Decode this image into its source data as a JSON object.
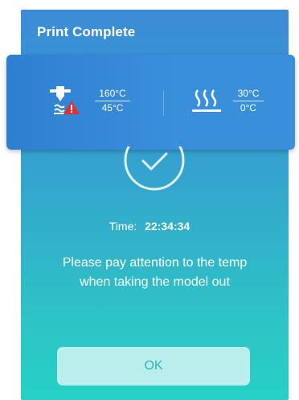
{
  "dialog": {
    "title": "Print Complete"
  },
  "temperatures": {
    "nozzle": {
      "icon": "nozzle-warning-icon",
      "target": "160°C",
      "current": "45°C"
    },
    "bed": {
      "icon": "heated-bed-icon",
      "target": "30°C",
      "current": "0°C"
    }
  },
  "status": {
    "icon": "check-circle-icon",
    "time_label": "Time:",
    "time_value": "22:34:34",
    "message_line1": "Please pay attention to the temp",
    "message_line2": "when taking the model out"
  },
  "actions": {
    "ok_label": "OK"
  },
  "colors": {
    "gradient_top": "#3c8bd6",
    "gradient_bottom": "#27d1c6",
    "warning": "#e0302f",
    "ok_text": "#2fb6b0"
  }
}
